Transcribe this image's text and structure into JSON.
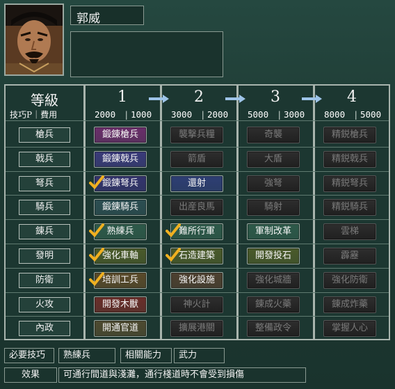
{
  "character": {
    "name": "郭威",
    "description": ""
  },
  "header": {
    "level_label": "等級",
    "sub_label": "技巧P｜費用",
    "levels": [
      {
        "num": "1",
        "points": "2000",
        "cost": "1000"
      },
      {
        "num": "2",
        "points": "3000",
        "cost": "2000"
      },
      {
        "num": "3",
        "points": "5000",
        "cost": "3000"
      },
      {
        "num": "4",
        "points": "8000",
        "cost": "5000"
      }
    ]
  },
  "rows": [
    {
      "category": "槍兵",
      "skills": [
        {
          "label": "鍛錬槍兵",
          "state": "on",
          "color": "#6a2e6a",
          "checked": false
        },
        {
          "label": "襲撃兵糧",
          "state": "off",
          "checked": false
        },
        {
          "label": "奇襲",
          "state": "off",
          "checked": false
        },
        {
          "label": "精鋭槍兵",
          "state": "off",
          "checked": false
        }
      ]
    },
    {
      "category": "戟兵",
      "skills": [
        {
          "label": "鍛錬戟兵",
          "state": "on",
          "color": "#3a3a7a",
          "checked": false
        },
        {
          "label": "箭盾",
          "state": "off",
          "checked": false
        },
        {
          "label": "大盾",
          "state": "off",
          "checked": false
        },
        {
          "label": "精鋭戟兵",
          "state": "off",
          "checked": false
        }
      ]
    },
    {
      "category": "弩兵",
      "skills": [
        {
          "label": "鍛錬弩兵",
          "state": "on",
          "color": "#34346e",
          "checked": true
        },
        {
          "label": "還射",
          "state": "on",
          "color": "#2e3e74",
          "checked": false
        },
        {
          "label": "強弩",
          "state": "off",
          "checked": false
        },
        {
          "label": "精鋭弩兵",
          "state": "off",
          "checked": false
        }
      ]
    },
    {
      "category": "騎兵",
      "skills": [
        {
          "label": "鍛錬騎兵",
          "state": "on",
          "color": "#2c4e52",
          "checked": false
        },
        {
          "label": "出産良馬",
          "state": "off",
          "checked": false
        },
        {
          "label": "騎射",
          "state": "off",
          "checked": false
        },
        {
          "label": "精鋭騎兵",
          "state": "off",
          "checked": false
        }
      ]
    },
    {
      "category": "錬兵",
      "skills": [
        {
          "label": "熟練兵",
          "state": "on",
          "color": "#2e5a4a",
          "checked": true
        },
        {
          "label": "難所行軍",
          "state": "on",
          "color": "#2e5a4a",
          "checked": true
        },
        {
          "label": "軍制改革",
          "state": "on",
          "color": "#2e5a4a",
          "checked": false
        },
        {
          "label": "雲梯",
          "state": "off",
          "checked": false
        }
      ]
    },
    {
      "category": "發明",
      "skills": [
        {
          "label": "強化車軸",
          "state": "on",
          "color": "#4a5a2a",
          "checked": true
        },
        {
          "label": "石造建築",
          "state": "on",
          "color": "#4a5a2a",
          "checked": true
        },
        {
          "label": "開發投石",
          "state": "on",
          "color": "#4a5a2a",
          "checked": false
        },
        {
          "label": "霹靂",
          "state": "off",
          "checked": false
        }
      ]
    },
    {
      "category": "防衛",
      "skills": [
        {
          "label": "培訓工兵",
          "state": "on",
          "color": "#5a4a2a",
          "checked": true
        },
        {
          "label": "強化設施",
          "state": "on",
          "color": "#4e4030",
          "checked": false
        },
        {
          "label": "強化城牆",
          "state": "off",
          "checked": false
        },
        {
          "label": "強化防衛",
          "state": "off",
          "checked": false
        }
      ]
    },
    {
      "category": "火攻",
      "skills": [
        {
          "label": "開發木獸",
          "state": "on",
          "color": "#6a2e2a",
          "checked": false
        },
        {
          "label": "神火計",
          "state": "off",
          "checked": false
        },
        {
          "label": "錬成火藥",
          "state": "off",
          "checked": false
        },
        {
          "label": "錬成炸藥",
          "state": "off",
          "checked": false
        }
      ]
    },
    {
      "category": "內政",
      "skills": [
        {
          "label": "開通官道",
          "state": "on",
          "color": "#4e4a30",
          "checked": false
        },
        {
          "label": "擴展港關",
          "state": "off",
          "checked": false
        },
        {
          "label": "整備政令",
          "state": "off",
          "checked": false
        },
        {
          "label": "掌握人心",
          "state": "off",
          "checked": false
        }
      ]
    }
  ],
  "footer": {
    "required_label": "必要技巧",
    "required_value": "熟練兵",
    "ability_label": "相關能力",
    "ability_value": "武力",
    "effect_label": "效果",
    "effect_value": "可通行間道與淺灘，通行棧道時不會受到損傷"
  }
}
